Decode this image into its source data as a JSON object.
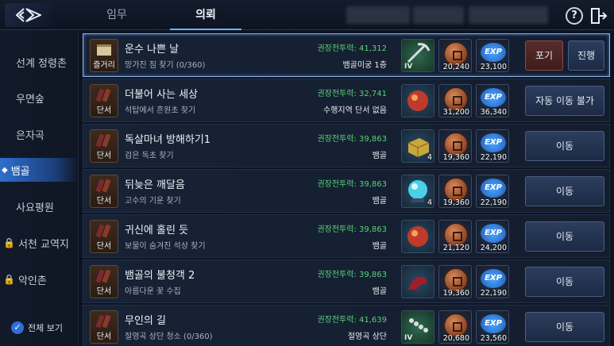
{
  "header": {
    "tabs": [
      {
        "label": "임무"
      },
      {
        "label": "의뢰"
      }
    ],
    "active_tab": "의뢰",
    "help_label": "?"
  },
  "sidebar": {
    "items": [
      {
        "label": "선계 정령촌",
        "locked": false
      },
      {
        "label": "우면숲",
        "locked": false
      },
      {
        "label": "은자곡",
        "locked": false
      },
      {
        "label": "뱀골",
        "locked": false,
        "active": true
      },
      {
        "label": "사요평원",
        "locked": false
      },
      {
        "label": "서천 교역지",
        "locked": true
      },
      {
        "label": "악인촌",
        "locked": true
      }
    ],
    "show_all_label": "전체 보기"
  },
  "quests": [
    {
      "icon_label": "즐거리",
      "title": "운수 나쁜 날",
      "sub": "망가진 짐 찾기 (0/360)",
      "power": "권장전투력: 41,312",
      "loc": "뱀골미궁 1층",
      "reward_item": "pickaxe",
      "reward_tier": "IV",
      "reward_item_count": "",
      "coins": "20,240",
      "exp": "23,100",
      "buttons": [
        "포기",
        "진행"
      ],
      "selected": true
    },
    {
      "icon_label": "단서",
      "title": "더불어 사는 세상",
      "sub": "석탑에서 흔원초 찾기",
      "power": "권장전투력: 32,741",
      "loc": "수행지역 단서 없음",
      "reward_item": "red-orb",
      "reward_tier": "",
      "reward_item_count": "",
      "coins": "31,200",
      "exp": "36,340",
      "buttons": [
        "자동 이동 불가"
      ]
    },
    {
      "icon_label": "단서",
      "title": "독살마녀 방해하기1",
      "sub": "검은 독초 찾기",
      "power": "권장전투력: 39,863",
      "loc": "뱀골",
      "reward_item": "gold-box",
      "reward_tier": "",
      "reward_item_count": "4",
      "coins": "19,360",
      "exp": "22,190",
      "buttons": [
        "이동"
      ]
    },
    {
      "icon_label": "단서",
      "title": "뒤늦은 깨달음",
      "sub": "고수의 기운 찾기",
      "power": "권장전투력: 39,863",
      "loc": "뱀골",
      "reward_item": "crystal-orb",
      "reward_tier": "",
      "reward_item_count": "4",
      "coins": "19,360",
      "exp": "22,190",
      "buttons": [
        "이동"
      ]
    },
    {
      "icon_label": "단서",
      "title": "귀신에 홀린 듯",
      "sub": "보물이 숨겨진 석상 찾기",
      "power": "권장전투력: 39,863",
      "loc": "뱀골",
      "reward_item": "red-orb",
      "reward_tier": "",
      "reward_item_count": "",
      "coins": "21,120",
      "exp": "24,200",
      "buttons": [
        "이동"
      ]
    },
    {
      "icon_label": "단서",
      "title": "뱀골의 불청객 2",
      "sub": "아름다운 꽃 수집",
      "power": "권장전투력: 39,863",
      "loc": "뱀골",
      "reward_item": "red-creature",
      "reward_tier": "",
      "reward_item_count": "",
      "coins": "19,360",
      "exp": "22,190",
      "buttons": [
        "이동"
      ]
    },
    {
      "icon_label": "단서",
      "title": "무인의 길",
      "sub": "절영곡 상단 청소 (0/360)",
      "power": "권장전투력: 41,639",
      "loc": "절영곡 상단",
      "reward_item": "bead-necklace",
      "reward_tier": "IV",
      "reward_item_count": "",
      "coins": "20,680",
      "exp": "23,560",
      "buttons": [
        "이동"
      ]
    }
  ],
  "exp_label": "EXP",
  "colors": {
    "power_green": "#5cd07a",
    "active_blue": "#2f6fd0",
    "giveup_red": "#5a2c2c"
  }
}
